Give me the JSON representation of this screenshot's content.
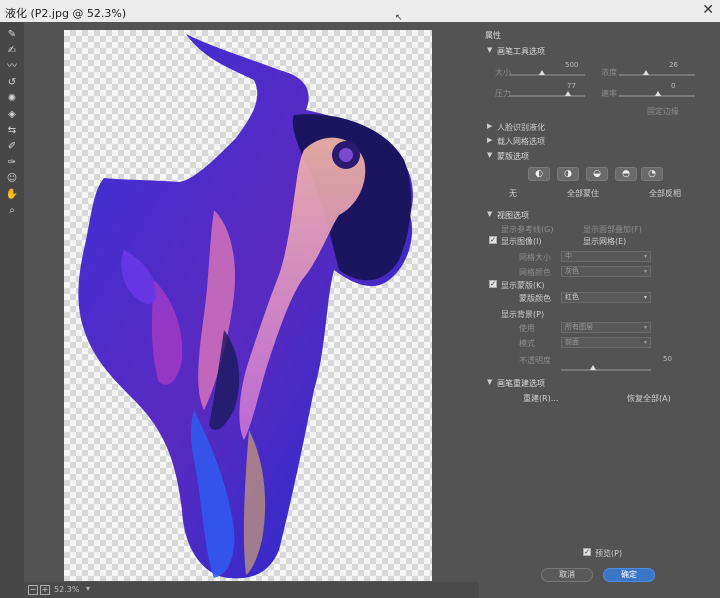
{
  "window": {
    "title": "液化 (P2.jpg @ 52.3%)",
    "close_glyph": "✕"
  },
  "tools": [
    {
      "name": "forward-warp-icon",
      "glyph": "✎"
    },
    {
      "name": "reconstruct-icon",
      "glyph": "✍"
    },
    {
      "name": "smooth-icon",
      "glyph": "〰"
    },
    {
      "name": "twirl-icon",
      "glyph": "↺"
    },
    {
      "name": "pucker-icon",
      "glyph": "✺"
    },
    {
      "name": "bloat-icon",
      "glyph": "◈"
    },
    {
      "name": "push-left-icon",
      "glyph": "⇆"
    },
    {
      "name": "freeze-mask-icon",
      "glyph": "✐"
    },
    {
      "name": "thaw-mask-icon",
      "glyph": "✑"
    },
    {
      "name": "face-tool-icon",
      "glyph": "☺"
    },
    {
      "name": "hand-icon",
      "glyph": "✋"
    },
    {
      "name": "zoom-icon",
      "glyph": "⌕"
    }
  ],
  "statusbar": {
    "zoom_value": "52.3%",
    "minus": "−",
    "plus": "+",
    "caret": "▾"
  },
  "panel": {
    "properties_label": "属性",
    "brush_tool_options": {
      "header": "画笔工具选项",
      "size_label": "大小",
      "size_value": "500",
      "density_label": "浓度",
      "density_value": "26",
      "pressure_label": "压力",
      "pressure_value": "77",
      "rate_label": "速率",
      "rate_value": "0",
      "pin_edges_label": "固定边缘"
    },
    "face_aware_header": "人脸识别液化",
    "load_mesh_header": "载入网格选项",
    "mask_options": {
      "header": "蒙版选项",
      "button_glyphs": [
        "◐",
        "◑",
        "◒",
        "◓",
        "◔"
      ],
      "none_label": "无",
      "mask_all_label": "全部蒙住",
      "invert_all_label": "全部反相"
    },
    "view_options": {
      "header": "视图选项",
      "show_guides": "显示参考线(G)",
      "show_face_overlay": "显示面部叠加(F)",
      "show_image": "显示图像(I)",
      "show_mesh": "显示网格(E)",
      "mesh_size_label": "网格大小",
      "mesh_size_value": "中",
      "mesh_color_label": "网格颜色",
      "mesh_color_value": "灰色",
      "show_mask": "显示蒙版(K)",
      "mask_color_label": "蒙版颜色",
      "mask_color_value": "红色",
      "show_backdrop": "显示背景(P)",
      "use_label": "使用",
      "use_value": "所有图层",
      "mode_label": "模式",
      "mode_value": "前面",
      "opacity_label": "不透明度",
      "opacity_value": "50"
    },
    "brush_reconstruct": {
      "header": "画笔重建选项",
      "reconstruct_label": "重建(R)...",
      "restore_all_label": "恢复全部(A)"
    },
    "preview_label": "预览(P)",
    "cancel_label": "取消",
    "ok_label": "确定",
    "checkmark": "✓",
    "expanded": "▼",
    "collapsed": "▶",
    "caret": "▾"
  },
  "colors": {
    "panel_bg": "#535353",
    "accent": "#3b75c7",
    "artwork_deep": "#2a1a8c",
    "artwork_blue": "#3a3ae0",
    "artwork_pink": "#f2a6c0",
    "artwork_magenta": "#b03cc8"
  }
}
